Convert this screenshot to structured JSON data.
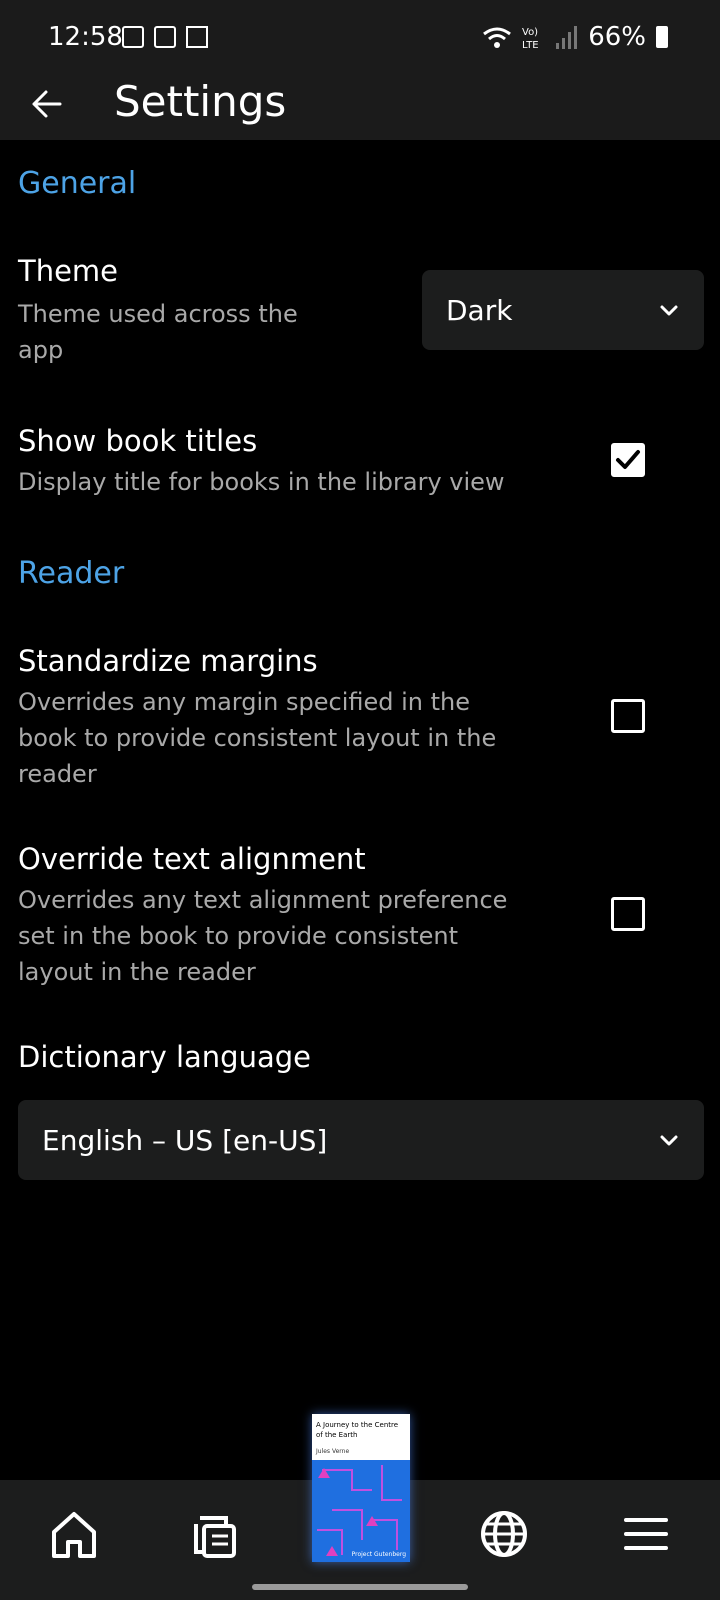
{
  "status": {
    "time": "12:58",
    "battery": "66%"
  },
  "appbar": {
    "title": "Settings"
  },
  "sections": {
    "general": "General",
    "reader": "Reader"
  },
  "settings": {
    "theme": {
      "title": "Theme",
      "desc": "Theme used across the app",
      "value": "Dark"
    },
    "show_titles": {
      "title": "Show book titles",
      "desc": "Display title for books in the library view",
      "checked": true
    },
    "standardize_margins": {
      "title": "Standardize margins",
      "desc": "Overrides any margin specified in the book to provide consistent layout in the reader",
      "checked": false
    },
    "override_alignment": {
      "title": "Override text alignment",
      "desc": "Overrides any text alignment preference set in the book to provide consistent layout in the reader",
      "checked": false
    },
    "dictionary": {
      "title": "Dictionary language",
      "value": "English – US [en-US]"
    }
  },
  "book": {
    "title": "A Journey to the Centre of the Earth",
    "author": "Jules Verne",
    "publisher": "Project Gutenberg"
  },
  "colors": {
    "accent": "#4da3e6",
    "background": "#000000",
    "surface": "#1c1d1d"
  },
  "icons": {
    "back": "arrow-left-icon",
    "home": "home-icon",
    "library": "library-icon",
    "web": "globe-icon",
    "menu": "menu-icon"
  }
}
